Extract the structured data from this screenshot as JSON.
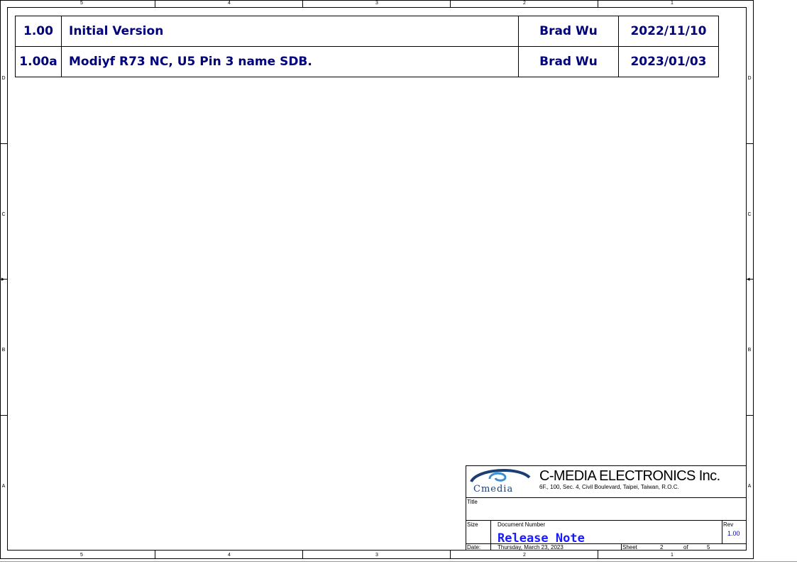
{
  "border": {
    "column_labels": [
      "5",
      "4",
      "3",
      "2",
      "1"
    ],
    "row_labels": [
      "D",
      "C",
      "B",
      "A"
    ]
  },
  "revision_history": [
    {
      "version": "1.00",
      "description": "Initial Version",
      "author": "Brad Wu",
      "date": "2022/11/10"
    },
    {
      "version": "1.00a",
      "description": "Modiyf R73 NC, U5 Pin 3 name SDB.",
      "author": "Brad Wu",
      "date": "2023/01/03"
    }
  ],
  "title_block": {
    "logo_text": "Cmedia",
    "company": "C-MEDIA ELECTRONICS Inc.",
    "address": "6F., 100, Sec. 4, Civil Boulevard, Taipei, Taiwan, R.O.C.",
    "title_label": "Title",
    "size_label": "Size",
    "doc_number_label": "Document Number",
    "rev_label": "Rev",
    "rev_value": "1.00",
    "doc_title": "Release Note",
    "date_label": "Date:",
    "date_value": "Thursday, March 23, 2023",
    "sheet_label": "Sheet",
    "sheet_num": "2",
    "of_label": "of",
    "sheet_total": "5"
  },
  "colors": {
    "revision_text": "#00007a",
    "doc_title": "#1a1aff",
    "logo": "#1c3f73"
  }
}
